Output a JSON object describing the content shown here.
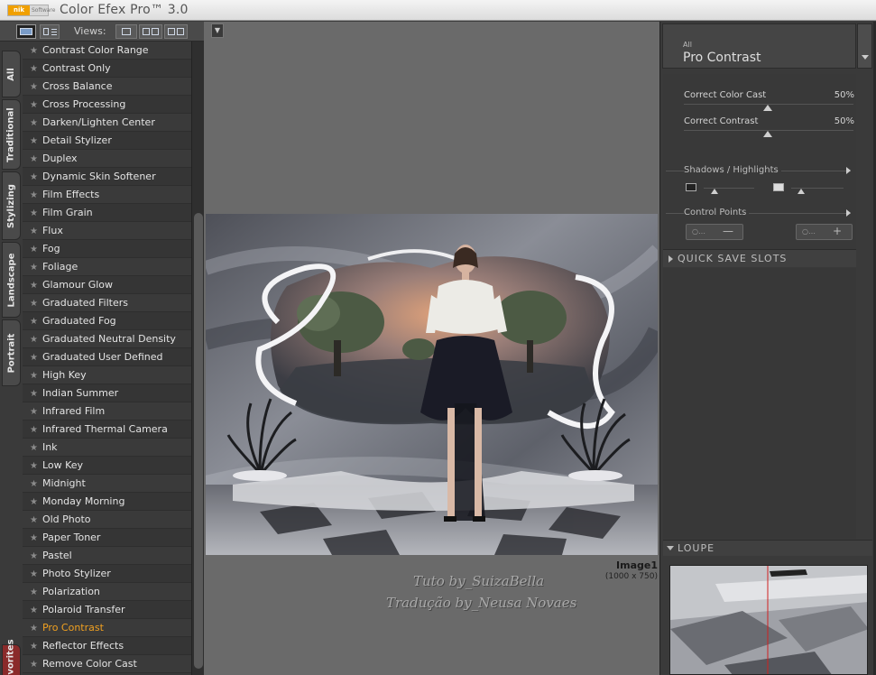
{
  "titlebar": {
    "logo_mark": "nik",
    "logo_sub": "Software",
    "app_title": "Color Efex Pro™ 3.0"
  },
  "views_bar": {
    "label": "Views:",
    "buttons": [
      "single-view-icon",
      "split-view-icon",
      "side-by-side-icon",
      "compare-icon",
      "compare-dual-icon"
    ]
  },
  "categories": {
    "tabs": [
      "All",
      "Traditional",
      "Stylizing",
      "Landscape",
      "Portrait",
      "Favorites"
    ]
  },
  "filters": {
    "items": [
      "Contrast Color Range",
      "Contrast Only",
      "Cross Balance",
      "Cross Processing",
      "Darken/Lighten Center",
      "Detail Stylizer",
      "Duplex",
      "Dynamic Skin Softener",
      "Film Effects",
      "Film Grain",
      "Flux",
      "Fog",
      "Foliage",
      "Glamour Glow",
      "Graduated Filters",
      "Graduated Fog",
      "Graduated Neutral Density",
      "Graduated User Defined",
      "High Key",
      "Indian Summer",
      "Infrared Film",
      "Infrared Thermal Camera",
      "Ink",
      "Low Key",
      "Midnight",
      "Monday Morning",
      "Old Photo",
      "Paper Toner",
      "Pastel",
      "Photo Stylizer",
      "Polarization",
      "Polaroid Transfer",
      "Pro Contrast",
      "Reflector Effects",
      "Remove Color Cast"
    ],
    "active": "Pro Contrast",
    "active_color": "#f0a020"
  },
  "canvas": {
    "image_name": "Image1",
    "image_dims": "(1000 x 750)",
    "watermark_line1": "Tuto by_SuizaBella",
    "watermark_line2": "Tradução by_Neusa Novaes"
  },
  "right_panel": {
    "category": "All",
    "filter_name": "Pro Contrast",
    "correct_color_cast_label": "Correct Color Cast",
    "correct_color_cast_value": "50%",
    "correct_contrast_label": "Correct Contrast",
    "correct_contrast_value": "50%",
    "shadows_highlights_label": "Shadows / Highlights",
    "control_points_label": "Control Points",
    "quick_save_label": "QUICK SAVE SLOTS",
    "loupe_label": "LOUPE"
  }
}
